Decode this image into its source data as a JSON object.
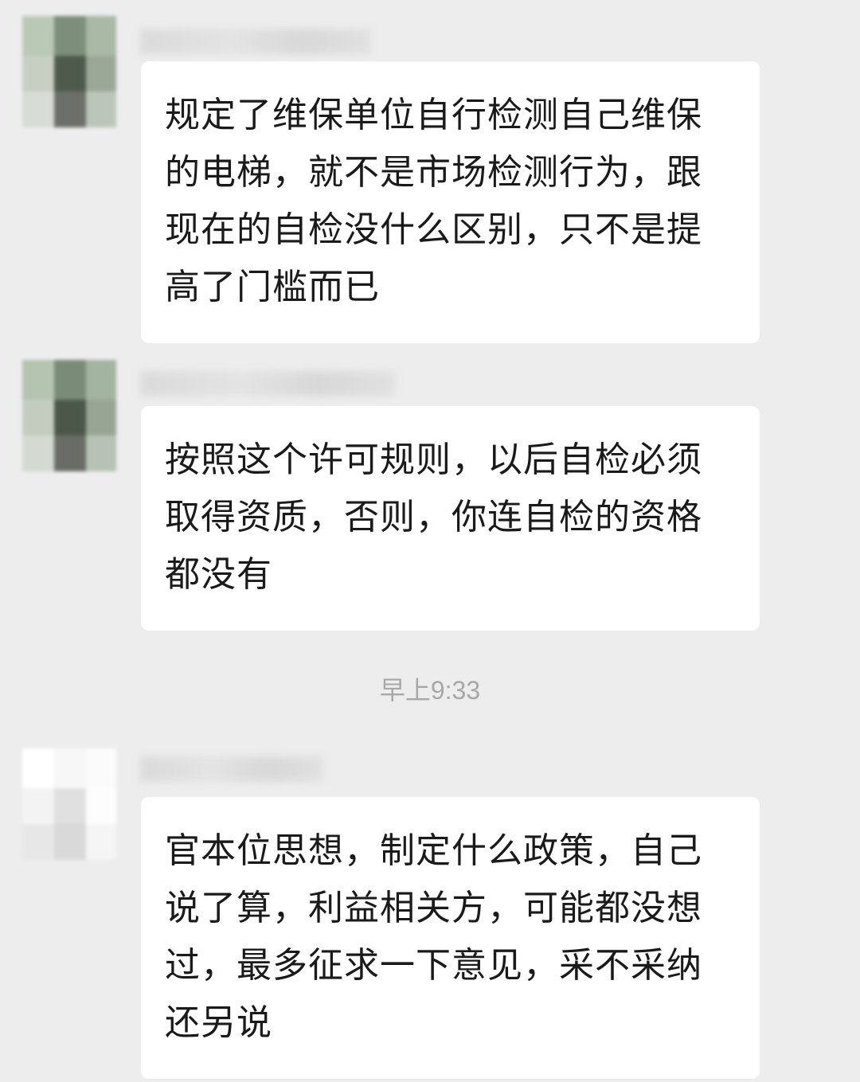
{
  "chat": {
    "timestamp": "早上9:33",
    "messages": [
      {
        "avatar": "blurred-avatar-green",
        "sender": "",
        "text": "规定了维保单位自行检测自己维保的电梯，就不是市场检测行为，跟现在的自检没什么区别，只不是提高了门槛而已"
      },
      {
        "avatar": "blurred-avatar-green",
        "sender": "",
        "text": "按照这个许可规则，以后自检必须取得资质，否则，你连自检的资格都没有"
      },
      {
        "avatar": "blurred-avatar-white",
        "sender": "",
        "text": "官本位思想，制定什么政策，自己说了算，利益相关方，可能都没想过，最多征求一下意见，采不采纳还另说"
      }
    ]
  }
}
